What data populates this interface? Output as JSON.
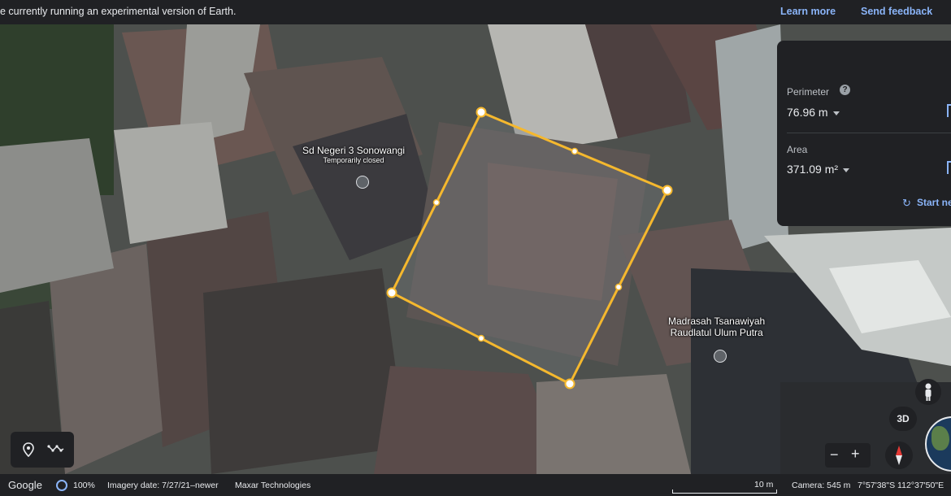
{
  "banner": {
    "message": "e currently running an experimental version of Earth.",
    "learn_more": "Learn more",
    "send_feedback": "Send feedback"
  },
  "places": [
    {
      "name": "Sd Negeri 3 Sonowangi",
      "status": "Temporarily closed"
    },
    {
      "name_line1": "Madrasah Tsanawiyah",
      "name_line2": "Raudlatul Ulum Putra"
    }
  ],
  "measure_panel": {
    "perimeter_label": "Perimeter",
    "perimeter_value": "76.96 m",
    "area_label": "Area",
    "area_value": "371.09 m²",
    "start_new": "Start ne"
  },
  "controls": {
    "three_d": "3D",
    "zoom_out": "−",
    "zoom_in": "+"
  },
  "status_bar": {
    "brand": "Google",
    "load_percent": "100%",
    "imagery_date": "Imagery date: 7/27/21–newer",
    "provider": "Maxar Technologies",
    "scale": "10 m",
    "camera": "Camera: 545 m",
    "coordinates": "7°57'38\"S 112°37'50\"E"
  },
  "colors": {
    "polygon": "#f5b82e",
    "panel_bg": "#202124",
    "link": "#8ab4f8"
  }
}
